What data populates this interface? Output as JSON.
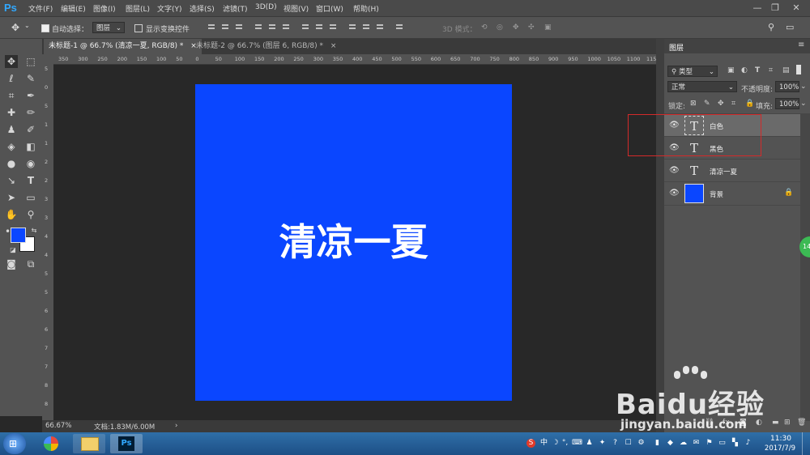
{
  "app": {
    "logo": "Ps"
  },
  "menu": [
    "文件(F)",
    "编辑(E)",
    "图像(I)",
    "图层(L)",
    "文字(Y)",
    "选择(S)",
    "滤镜(T)",
    "3D(D)",
    "视图(V)",
    "窗口(W)",
    "帮助(H)"
  ],
  "options": {
    "auto_select_label": "自动选择：",
    "auto_select_value": "图层",
    "show_transform_label": "显示变换控件",
    "mode_3d_label": "3D 模式："
  },
  "tabs": [
    {
      "label": "未标题-1 @ 66.7% (清凉一夏, RGB/8) *",
      "close": "×"
    },
    {
      "label": "未标题-2 @ 66.7% (图层 6, RGB/8) *",
      "close": "×"
    }
  ],
  "ruler_top": [
    "350",
    "300",
    "250",
    "200",
    "150",
    "100",
    "50",
    "0",
    "50",
    "100",
    "150",
    "200",
    "250",
    "300",
    "350",
    "400",
    "450",
    "500",
    "550",
    "600",
    "650",
    "700",
    "750",
    "800",
    "850",
    "900",
    "950",
    "1000",
    "1050",
    "1100",
    "1150"
  ],
  "ruler_left": [
    "5",
    "0",
    "5",
    "1",
    "1",
    "2",
    "2",
    "3",
    "3",
    "4",
    "4",
    "5",
    "5",
    "6",
    "6",
    "7",
    "7",
    "8",
    "8"
  ],
  "canvas": {
    "text": "清凉一夏",
    "bg_color": "#0a46ff"
  },
  "status": {
    "zoom": "66.67%",
    "doc_info": "文档:1.83M/6.00M",
    "arrow": "›"
  },
  "layers_panel": {
    "title": "图层",
    "filter_label": "类型",
    "blend_mode": "正常",
    "opacity_label": "不透明度:",
    "opacity_value": "100%",
    "lock_label": "锁定:",
    "fill_label": "填充:",
    "fill_value": "100%",
    "layers": [
      {
        "name": "白色",
        "kind": "T"
      },
      {
        "name": "黑色",
        "kind": "T"
      },
      {
        "name": "清凉一夏",
        "kind": "T"
      },
      {
        "name": "背景",
        "kind": "fill"
      }
    ],
    "bottom_icons": [
      "fx",
      "mask",
      "adjust",
      "group",
      "new",
      "delete"
    ]
  },
  "taskbar": {
    "time": "11:30",
    "date": "2017/7/9",
    "ime": "中",
    "ps_icon": "Ps"
  },
  "watermark": {
    "brand": "Baidu经验",
    "url": "jingyan.baidu.com"
  },
  "side_badge": "14"
}
